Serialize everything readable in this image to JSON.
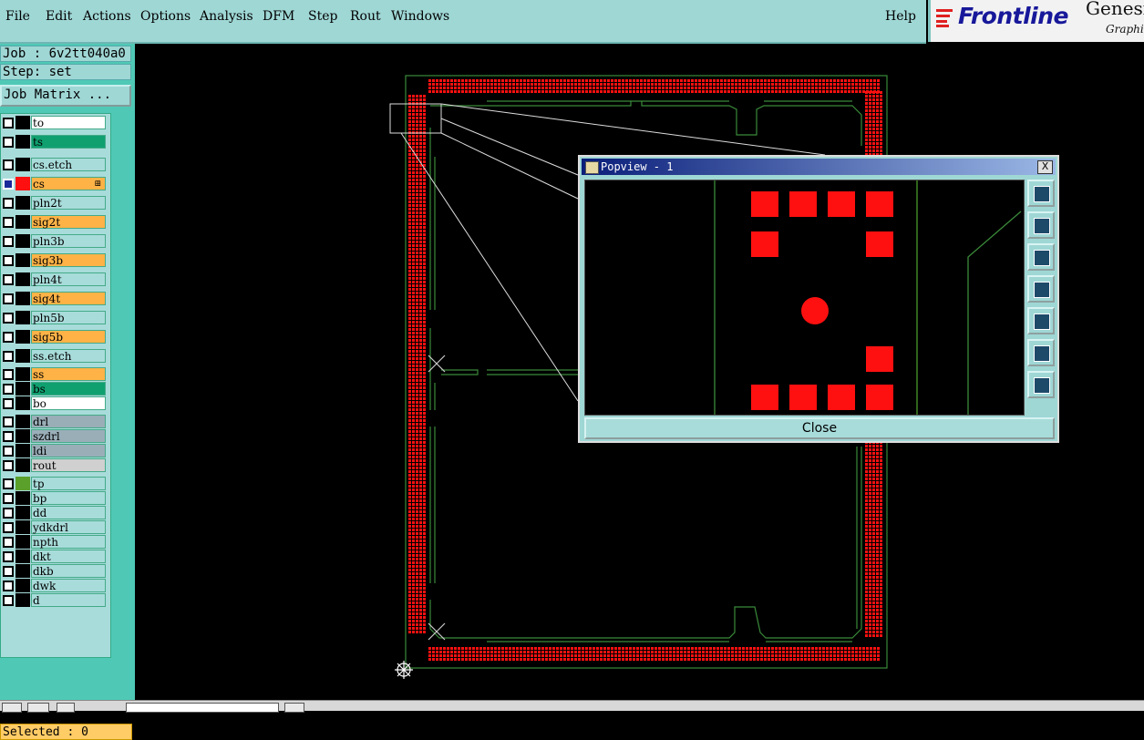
{
  "menu": {
    "items": [
      "File",
      "Edit",
      "Actions",
      "Options",
      "Analysis",
      "DFM",
      "Step",
      "Rout",
      "Windows"
    ],
    "help": "Help"
  },
  "logo": {
    "brand": "Frontline",
    "product": "Genesis",
    "sub": "Graphic"
  },
  "job": {
    "job_line": "Job : 6v2tt040a0",
    "step_line": "Step: set",
    "matrix_button": "Job Matrix ..."
  },
  "layers": [
    {
      "name": "to",
      "color": "#ffffff",
      "swatch": ""
    },
    {
      "name": "ts",
      "color": "#10a070",
      "swatch": ""
    },
    {
      "name": "cs.etch",
      "color": "#a8dcda",
      "swatch": ""
    },
    {
      "name": "cs",
      "color": "#ffb347",
      "swatch": "#ff1010",
      "active": true
    },
    {
      "name": "pln2t",
      "color": "#a8dcda",
      "swatch": ""
    },
    {
      "name": "sig2t",
      "color": "#ffb347",
      "swatch": ""
    },
    {
      "name": "pln3b",
      "color": "#a8dcda",
      "swatch": ""
    },
    {
      "name": "sig3b",
      "color": "#ffb347",
      "swatch": ""
    },
    {
      "name": "pln4t",
      "color": "#a8dcda",
      "swatch": ""
    },
    {
      "name": "sig4t",
      "color": "#ffb347",
      "swatch": ""
    },
    {
      "name": "pln5b",
      "color": "#a8dcda",
      "swatch": ""
    },
    {
      "name": "sig5b",
      "color": "#ffb347",
      "swatch": ""
    },
    {
      "name": "ss.etch",
      "color": "#a8dcda",
      "swatch": ""
    },
    {
      "name": "ss",
      "color": "#ffb347",
      "swatch": ""
    },
    {
      "name": "bs",
      "color": "#10a070",
      "swatch": ""
    },
    {
      "name": "bo",
      "color": "#ffffff",
      "swatch": ""
    },
    {
      "name": "drl",
      "color": "#9aaeb8",
      "swatch": ""
    },
    {
      "name": "szdrl",
      "color": "#9aaeb8",
      "swatch": ""
    },
    {
      "name": "ldi",
      "color": "#9aaeb8",
      "swatch": ""
    },
    {
      "name": "rout",
      "color": "#d0d0d0",
      "swatch": ""
    },
    {
      "name": "tp",
      "color": "#a8dcda",
      "swatch": "#5aa02a"
    },
    {
      "name": "bp",
      "color": "#a8dcda",
      "swatch": ""
    },
    {
      "name": "dd",
      "color": "#a8dcda",
      "swatch": ""
    },
    {
      "name": "ydkdrl",
      "color": "#a8dcda",
      "swatch": ""
    },
    {
      "name": "npth",
      "color": "#a8dcda",
      "swatch": ""
    },
    {
      "name": "dkt",
      "color": "#a8dcda",
      "swatch": ""
    },
    {
      "name": "dkb",
      "color": "#a8dcda",
      "swatch": ""
    },
    {
      "name": "dwk",
      "color": "#a8dcda",
      "swatch": ""
    },
    {
      "name": "d",
      "color": "#a8dcda",
      "swatch": ""
    }
  ],
  "status": {
    "selected": "Selected : 0"
  },
  "popview": {
    "title": "Popview - 1",
    "close_label": "Close",
    "close_x": "X"
  },
  "colors": {
    "pad": "#ff1010",
    "outline": "#3a8a3a",
    "menu_bg": "#9fd7d5",
    "panel_bg": "#4fc9b6"
  }
}
